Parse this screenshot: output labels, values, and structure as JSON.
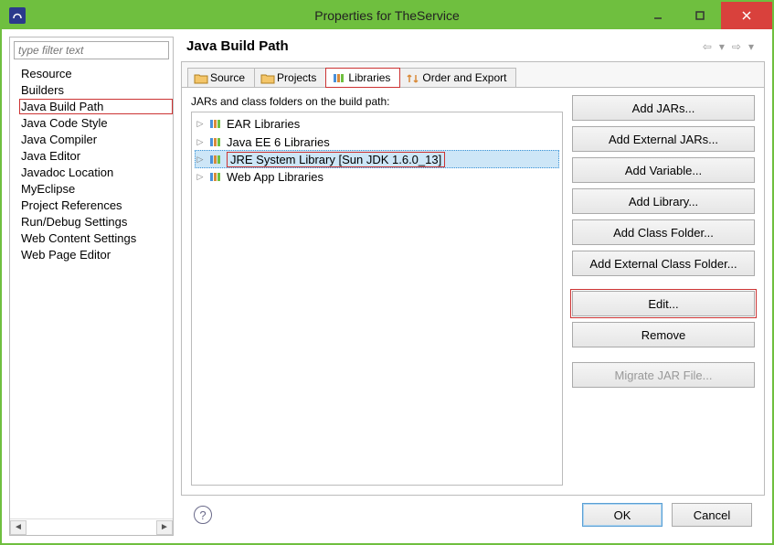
{
  "window": {
    "title": "Properties for TheService"
  },
  "sidebar": {
    "filter_placeholder": "type filter text",
    "items": [
      "Resource",
      "Builders",
      "Java Build Path",
      "Java Code Style",
      "Java Compiler",
      "Java Editor",
      "Javadoc Location",
      "MyEclipse",
      "Project References",
      "Run/Debug Settings",
      "Web Content Settings",
      "Web Page Editor"
    ],
    "highlighted_index": 2
  },
  "main": {
    "title": "Java Build Path",
    "tabs": [
      "Source",
      "Projects",
      "Libraries",
      "Order and Export"
    ],
    "active_tab_index": 2,
    "build_label": "JARs and class folders on the build path:",
    "tree": [
      "EAR Libraries",
      "Java EE 6 Libraries",
      "JRE System Library [Sun JDK 1.6.0_13]",
      "Web App Libraries"
    ],
    "selected_tree_index": 2,
    "buttons": {
      "add_jars": "Add JARs...",
      "add_ext_jars": "Add External JARs...",
      "add_var": "Add Variable...",
      "add_lib": "Add Library...",
      "add_cf": "Add Class Folder...",
      "add_ext_cf": "Add External Class Folder...",
      "edit": "Edit...",
      "remove": "Remove",
      "migrate": "Migrate JAR File..."
    }
  },
  "footer": {
    "ok": "OK",
    "cancel": "Cancel"
  }
}
